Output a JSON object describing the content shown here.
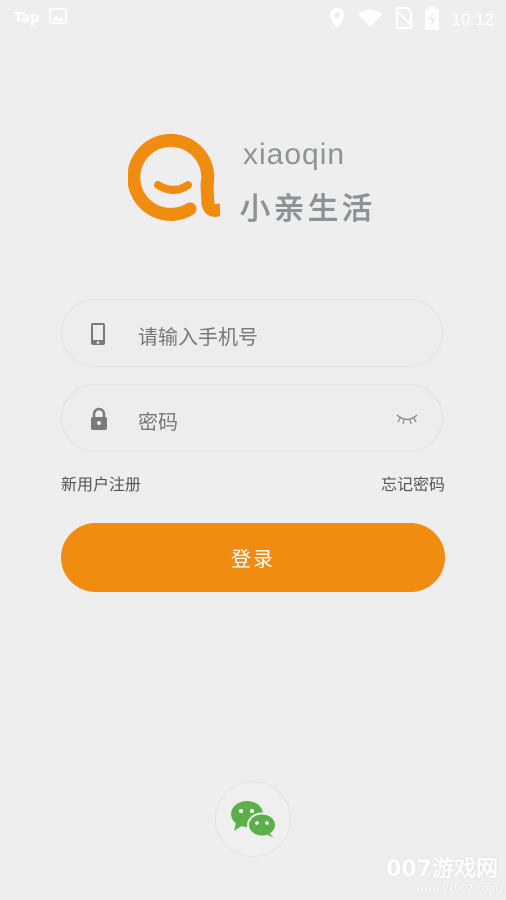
{
  "status_bar": {
    "notification_label": "Tap",
    "time": "10:12",
    "icons": [
      "image-icon",
      "location-icon",
      "wifi-icon",
      "no-sim-icon",
      "battery-charging-icon"
    ]
  },
  "brand": {
    "english_name": "xiaoqin",
    "chinese_name": "小亲生活",
    "logo_color": "#f08c10",
    "text_color": "#8a9396"
  },
  "form": {
    "phone_placeholder": "请输入手机号",
    "password_placeholder": "密码",
    "register_label": "新用户注册",
    "forgot_label": "忘记密码",
    "login_label": "登录"
  },
  "social_login": {
    "icon": "wechat-icon"
  },
  "watermark": {
    "title": "007游戏网",
    "url": "www.yx007.com"
  },
  "colors": {
    "background": "#eeeeee",
    "accent": "#f08c10",
    "wechat_green": "#5cb04a"
  }
}
